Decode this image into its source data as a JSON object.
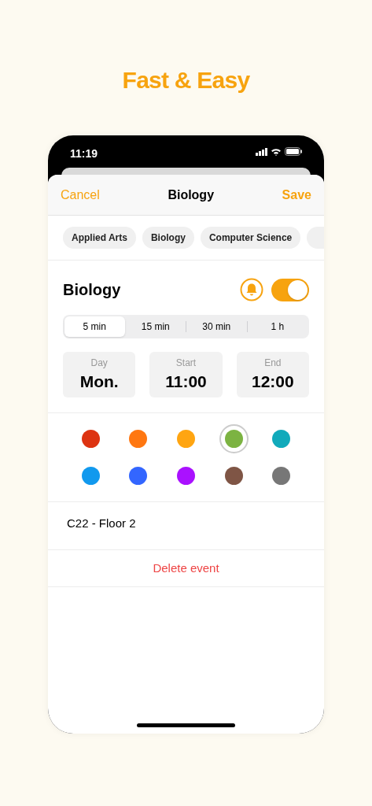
{
  "headline": "Fast & Easy",
  "status_bar": {
    "time": "11:19"
  },
  "header": {
    "cancel": "Cancel",
    "title": "Biology",
    "save": "Save"
  },
  "categories": [
    "Applied Arts",
    "Biology",
    "Computer Science"
  ],
  "event": {
    "name": "Biology",
    "reminder_on": true
  },
  "reminder_options": [
    {
      "label": "5 min",
      "selected": true
    },
    {
      "label": "15 min",
      "selected": false
    },
    {
      "label": "30 min",
      "selected": false
    },
    {
      "label": "1 h",
      "selected": false
    }
  ],
  "fields": [
    {
      "label": "Day",
      "value": "Mon."
    },
    {
      "label": "Start",
      "value": "11:00"
    },
    {
      "label": "End",
      "value": "12:00"
    }
  ],
  "colors": [
    {
      "color": "#dd3311",
      "selected": false
    },
    {
      "color": "#ff7711",
      "selected": false
    },
    {
      "color": "#ffa511",
      "selected": false
    },
    {
      "color": "#7cb342",
      "selected": true
    },
    {
      "color": "#11aabb",
      "selected": false
    },
    {
      "color": "#1199ee",
      "selected": false
    },
    {
      "color": "#3366ff",
      "selected": false
    },
    {
      "color": "#aa11ff",
      "selected": false
    },
    {
      "color": "#7f5545",
      "selected": false
    },
    {
      "color": "#777777",
      "selected": false
    }
  ],
  "location": "C22 - Floor 2",
  "delete_label": "Delete event"
}
